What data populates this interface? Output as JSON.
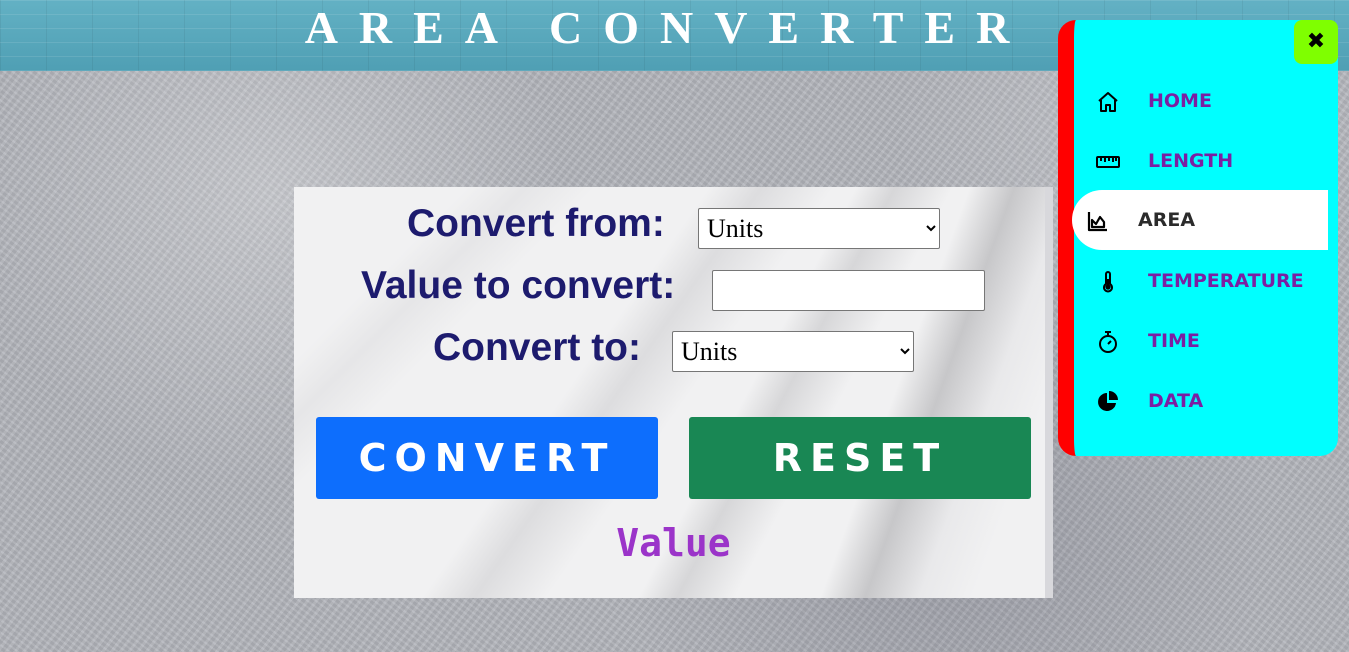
{
  "header": {
    "title": "AREA CONVERTER"
  },
  "converter": {
    "from_label": "Convert from:",
    "from_selected": "Units",
    "value_label": "Value to convert:",
    "value_input": "",
    "to_label": "Convert to:",
    "to_selected": "Units",
    "convert_button": "CONVERT",
    "reset_button": "RESET",
    "result": "Value"
  },
  "sidebar": {
    "close_icon": "close-icon",
    "items": [
      {
        "label": "HOME",
        "icon": "home-icon",
        "active": false
      },
      {
        "label": "LENGTH",
        "icon": "ruler-icon",
        "active": false
      },
      {
        "label": "AREA",
        "icon": "area-chart-icon",
        "active": true
      },
      {
        "label": "TEMPERATURE",
        "icon": "thermometer-icon",
        "active": false
      },
      {
        "label": "TIME",
        "icon": "stopwatch-icon",
        "active": false
      },
      {
        "label": "DATA",
        "icon": "pie-chart-icon",
        "active": false
      }
    ]
  },
  "colors": {
    "title_text": "#ffffff",
    "label_text": "#1d1b6e",
    "convert_button": "#0d6efd",
    "reset_button": "#198754",
    "result_text": "#9b34c9",
    "sidebar_bg": "#00ffff",
    "sidebar_accent": "#ff0000",
    "nav_text": "#7b1fa2",
    "close_button": "#7fff00"
  }
}
